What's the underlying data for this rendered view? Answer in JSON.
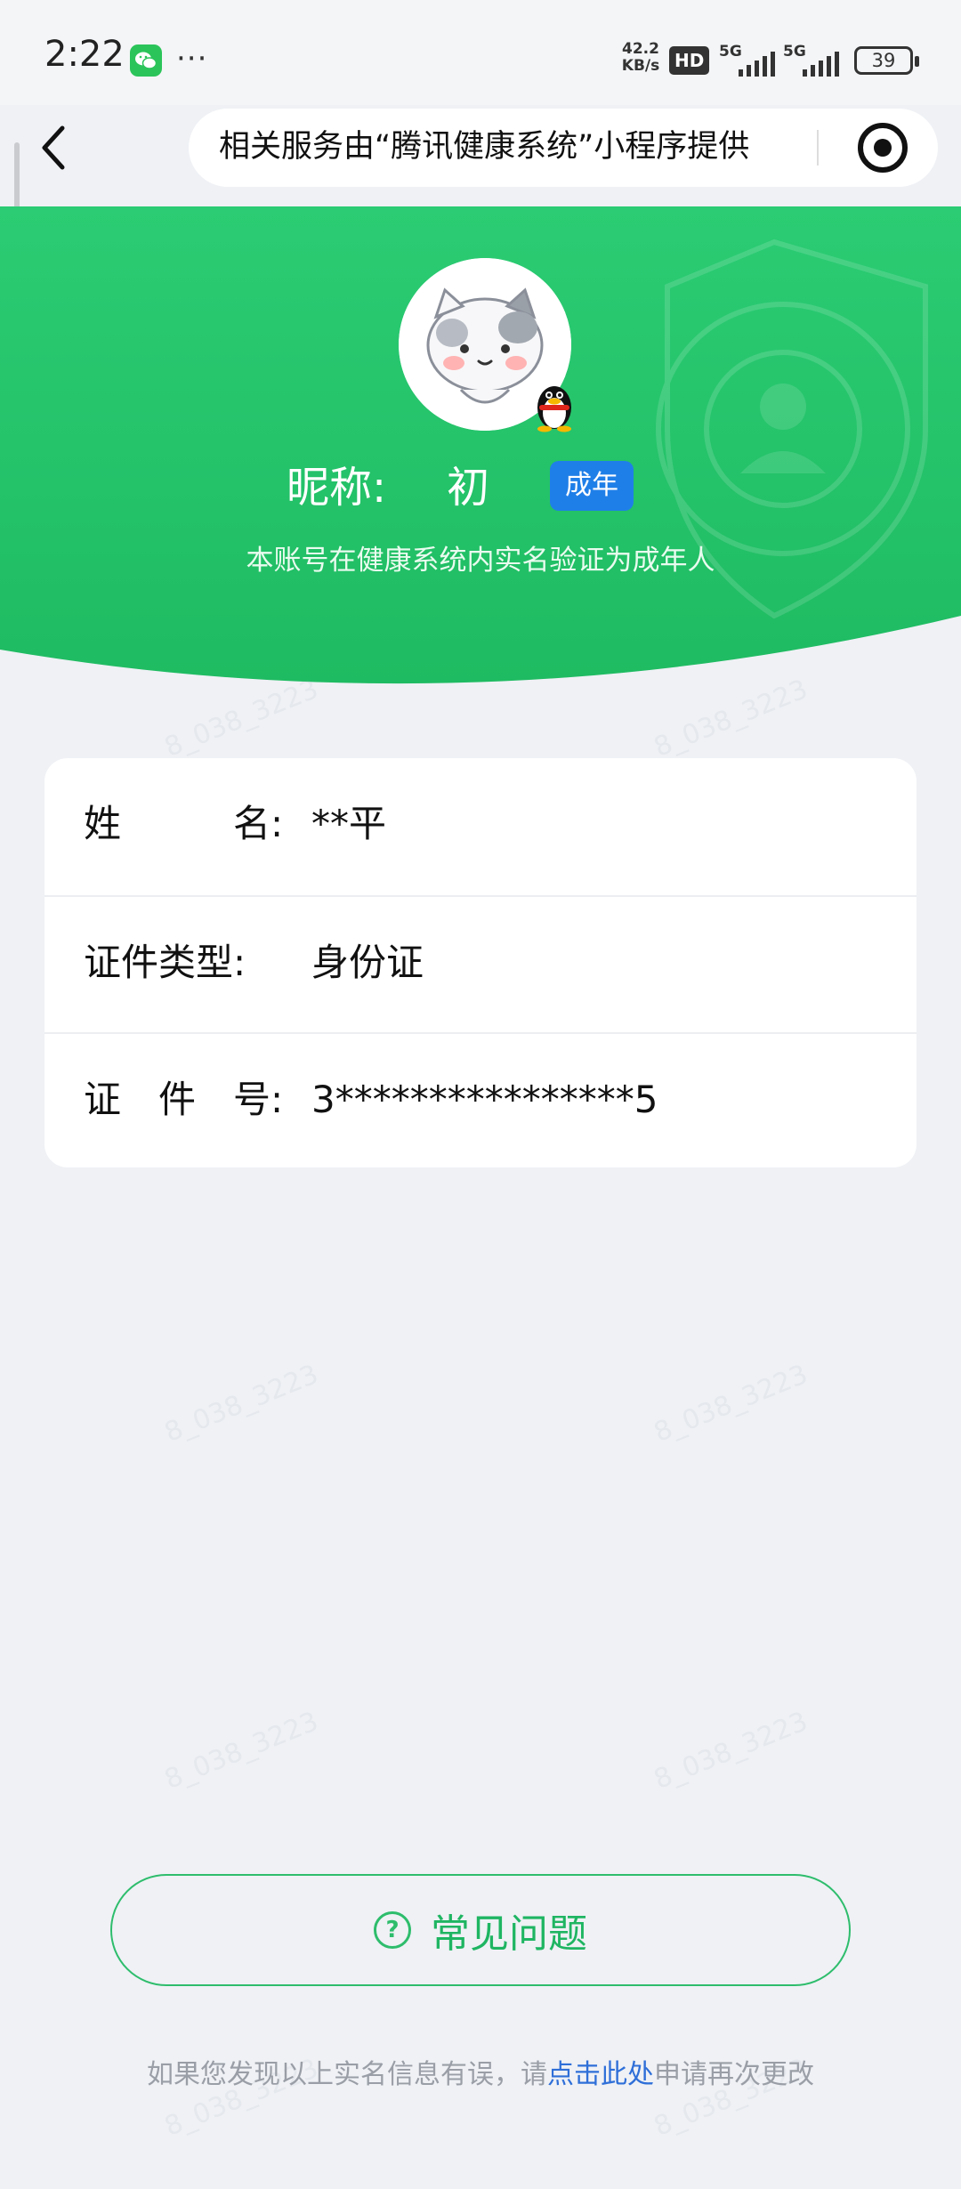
{
  "status_bar": {
    "time": "2:22",
    "more": "···",
    "net_speed_value": "42.2",
    "net_speed_unit": "KB/s",
    "hd_label": "HD",
    "signal_1_label": "5G",
    "signal_2_label": "5G",
    "battery_level": "39"
  },
  "nav": {
    "banner_text": "相关服务由“腾讯健康系统”小程序提供"
  },
  "profile": {
    "nickname_label": "昵称:",
    "nickname": "初",
    "age_badge": "成年",
    "verify_note": "本账号在健康系统内实名验证为成年人"
  },
  "info": {
    "rows": [
      {
        "label": "姓　　　名:",
        "value": "**平"
      },
      {
        "label": "证件类型:",
        "value": "身份证"
      },
      {
        "label": "证　件　号:",
        "value": "3****************5"
      }
    ]
  },
  "faq": {
    "icon_text": "?",
    "label": "常见问题"
  },
  "footer": {
    "prefix": "如果您发现以上实名信息有误，请",
    "link": "点击此处",
    "suffix": "申请再次更改"
  },
  "watermark": {
    "text": "8_038_3223"
  },
  "colors": {
    "header_green": "#27c46b",
    "badge_blue": "#1f7fe8",
    "faq_green": "#2ebd6c",
    "link_blue": "#2f6fd8",
    "page_background": "#eff1f5"
  }
}
